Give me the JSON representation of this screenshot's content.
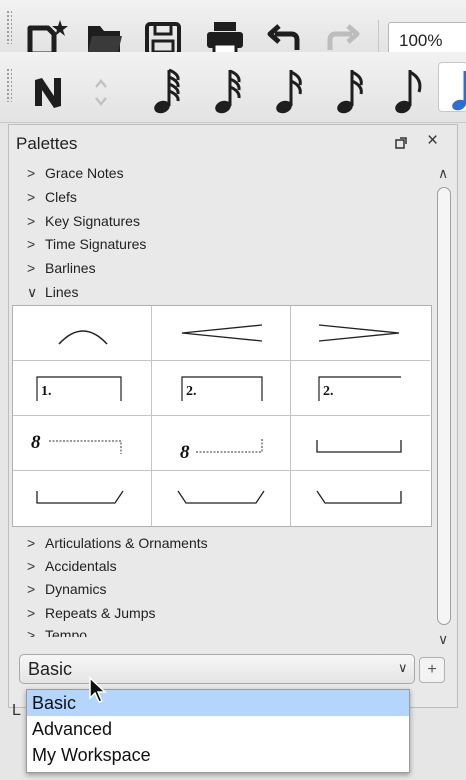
{
  "toolbar": {
    "zoom": "100%",
    "icons": [
      "new-score-icon",
      "open-icon",
      "save-icon",
      "print-icon",
      "undo-icon",
      "redo-icon"
    ],
    "note_icons": [
      "note-input-icon",
      "spinner-icon",
      "64th-note-icon",
      "32nd-note-icon",
      "16th-note-icon",
      "16th-note-icon",
      "8th-note-icon",
      "quarter-note-icon"
    ]
  },
  "palette": {
    "title": "Palettes",
    "close": "×",
    "categories_top": [
      "Grace Notes",
      "Clefs",
      "Key Signatures",
      "Time Signatures",
      "Barlines"
    ],
    "expanded_category": "Lines",
    "grid": [
      [
        "slur",
        "crescendo-hairpin",
        "diminuendo-hairpin"
      ],
      [
        "volta-1",
        "volta-2-closed",
        "volta-2-open"
      ],
      [
        "ottava-8va",
        "ottava-8vb",
        "pedal-bracket"
      ],
      [
        "pedal-bracket-right-angle",
        "pedal-bracket-both-angled",
        "pedal-bracket-left-angle"
      ]
    ],
    "grid_labels": {
      "volta1": "1.",
      "volta2": "2.",
      "ottava": "8"
    },
    "categories_bottom": [
      "Articulations & Ornaments",
      "Accidentals",
      "Dynamics",
      "Repeats & Jumps",
      "Tempo"
    ]
  },
  "workspace": {
    "selected": "Basic",
    "add_label": "+",
    "options": [
      "Basic",
      "Advanced",
      "My Workspace"
    ],
    "underlap_text": "L"
  },
  "colors": {
    "accent": "#2b6fd6",
    "selected_option": "#b4d5fe"
  }
}
